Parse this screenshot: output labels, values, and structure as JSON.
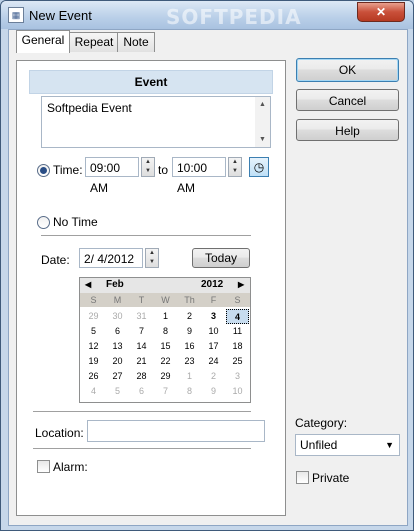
{
  "window": {
    "title": "New Event",
    "watermark": "SOFTPEDIA",
    "close_glyph": "✕",
    "icon": "calendar-icon"
  },
  "tabs": [
    {
      "label": "General"
    },
    {
      "label": "Repeat"
    },
    {
      "label": "Note"
    }
  ],
  "event": {
    "header": "Event",
    "description": "Softpedia Event",
    "time_label": "Time:",
    "start_time": "09:00 AM",
    "to_label": "to",
    "end_time": "10:00 AM",
    "no_time_label": "No Time",
    "date_label": "Date:",
    "date_value": "2/  4/2012",
    "today_button": "Today",
    "location_label": "Location:",
    "location_value": "",
    "alarm_label": "Alarm:"
  },
  "calendar": {
    "month": "Feb",
    "year": "2012",
    "prev_glyph": "◀",
    "next_glyph": "▶",
    "day_names": [
      "S",
      "M",
      "T",
      "W",
      "Th",
      "F",
      "S"
    ],
    "weeks": [
      [
        "29",
        "30",
        "31",
        "1",
        "2",
        "3",
        "4"
      ],
      [
        "5",
        "6",
        "7",
        "8",
        "9",
        "10",
        "11"
      ],
      [
        "12",
        "13",
        "14",
        "15",
        "16",
        "17",
        "18"
      ],
      [
        "19",
        "20",
        "21",
        "22",
        "23",
        "24",
        "25"
      ],
      [
        "26",
        "27",
        "28",
        "29",
        "1",
        "2",
        "3"
      ],
      [
        "4",
        "5",
        "6",
        "7",
        "8",
        "9",
        "10"
      ]
    ],
    "selected_day": "4"
  },
  "buttons": {
    "ok": "OK",
    "cancel": "Cancel",
    "help": "Help"
  },
  "side": {
    "category_label": "Category:",
    "category_value": "Unfiled",
    "private_label": "Private"
  },
  "colors": {
    "accent": "#3c7fb1",
    "header_bg": "#d6e4f1",
    "close_red": "#c9503a"
  }
}
